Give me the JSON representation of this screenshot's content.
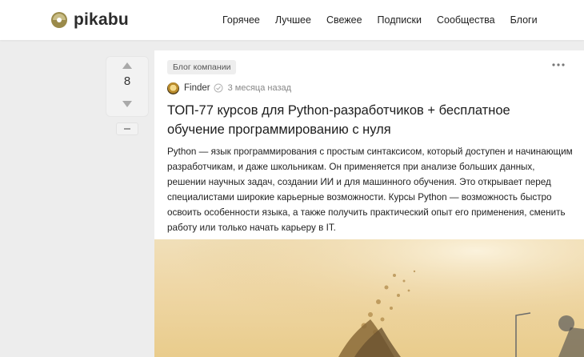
{
  "header": {
    "logo_text": "pikabu",
    "nav": [
      "Горячее",
      "Лучшее",
      "Свежее",
      "Подписки",
      "Сообщества",
      "Блоги"
    ]
  },
  "rating": {
    "value": "8"
  },
  "post": {
    "badge": "Блог компании",
    "author": "Finder",
    "time": "3 месяца назад",
    "title": "ТОП-77 курсов для Python-разработчиков + бесплатное обучение программированию с нуля",
    "body": "Python — язык программирования с простым синтаксисом, который доступен и  начинающим разработчикам, и даже школьникам. Он применяется при анализе больших данных, решении научных задач, создании ИИ и для машинного обучения. Это открывает перед специалистами широкие карьерные возможности. Курсы Python — возможность быстро освоить особенности языка, а также получить практический опыт его применения, сменить работу или только начать карьеру в IT."
  },
  "colors": {
    "accent": "#8a7a3a",
    "vote_icon": "#a9a9a9"
  },
  "icons": [
    "pikabu-logo-icon",
    "vote-up-icon",
    "vote-down-icon",
    "minus-icon",
    "more-icon",
    "verified-icon"
  ]
}
